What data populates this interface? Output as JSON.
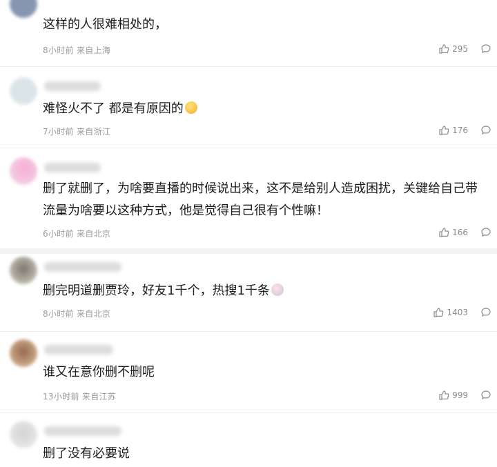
{
  "comments": [
    {
      "text": "这样的人很难相处的，",
      "time": "8小时前",
      "location": "来自上海",
      "likes": "295"
    },
    {
      "text": "难怪火不了 都是有原因的",
      "time": "7小时前",
      "location": "来自浙江",
      "likes": "176"
    },
    {
      "text": "删了就删了，为啥要直播的时候说出来，这不是给别人造成困扰，关键给自己带流量为啥要以这种方式，他是觉得自己很有个性嘛！",
      "time": "6小时前",
      "location": "来自北京",
      "likes": "166"
    },
    {
      "text": "删完明道删贾玲，好友1千个，热搜1千条",
      "time": "8小时前",
      "location": "来自北京",
      "likes": "1403"
    },
    {
      "text": "谁又在意你删不删呢",
      "time": "13小时前",
      "location": "来自江苏",
      "likes": "999"
    },
    {
      "text": "删了没有必要说",
      "time": "",
      "location": "",
      "likes": ""
    }
  ],
  "icons": {
    "like": "thumbs-up-icon",
    "reply": "comment-bubble-icon"
  }
}
